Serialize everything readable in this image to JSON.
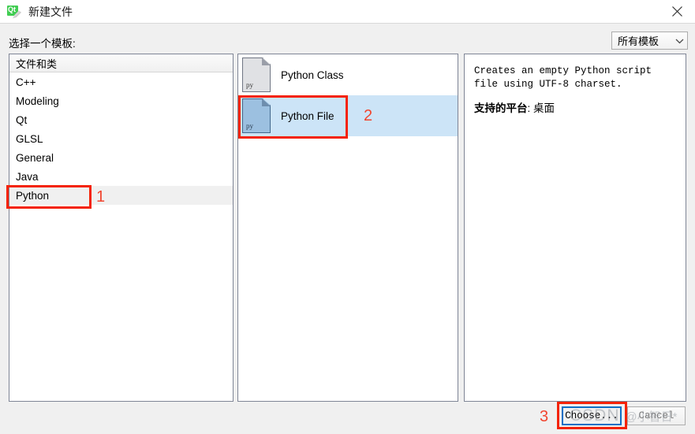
{
  "window": {
    "title": "新建文件",
    "app_icon": "qt-new-file-icon",
    "close_label": "✕"
  },
  "header": {
    "choose_template_label": "选择一个模板:",
    "filter_combo": {
      "selected": "所有模板",
      "arrow_icon": "chevron-down-icon"
    }
  },
  "left_panel": {
    "header": "文件和类",
    "items": [
      {
        "label": "C++",
        "selected": false
      },
      {
        "label": "Modeling",
        "selected": false
      },
      {
        "label": "Qt",
        "selected": false
      },
      {
        "label": "GLSL",
        "selected": false
      },
      {
        "label": "General",
        "selected": false
      },
      {
        "label": "Java",
        "selected": false
      },
      {
        "label": "Python",
        "selected": true
      }
    ]
  },
  "middle_panel": {
    "items": [
      {
        "label": "Python Class",
        "icon": "python-file-icon",
        "ext": "py",
        "selected": false
      },
      {
        "label": "Python File",
        "icon": "python-file-icon",
        "ext": "py",
        "selected": true
      }
    ]
  },
  "right_panel": {
    "description": "Creates an empty Python script file using UTF-8 charset.",
    "platform_label": "支持的平台",
    "platform_separator": ": ",
    "platform_value": "桌面"
  },
  "footer": {
    "choose_button": "Choose...",
    "cancel_button": "Cancel"
  },
  "annotations": {
    "markers": [
      {
        "number": "1",
        "target": "left-panel-python-item"
      },
      {
        "number": "2",
        "target": "middle-panel-python-file-item"
      },
      {
        "number": "3",
        "target": "choose-button"
      }
    ],
    "highlight_color": "#f42306",
    "number_color": "#f1452f"
  },
  "watermark": {
    "brand": "CSDN",
    "handle": "@小智日*"
  }
}
